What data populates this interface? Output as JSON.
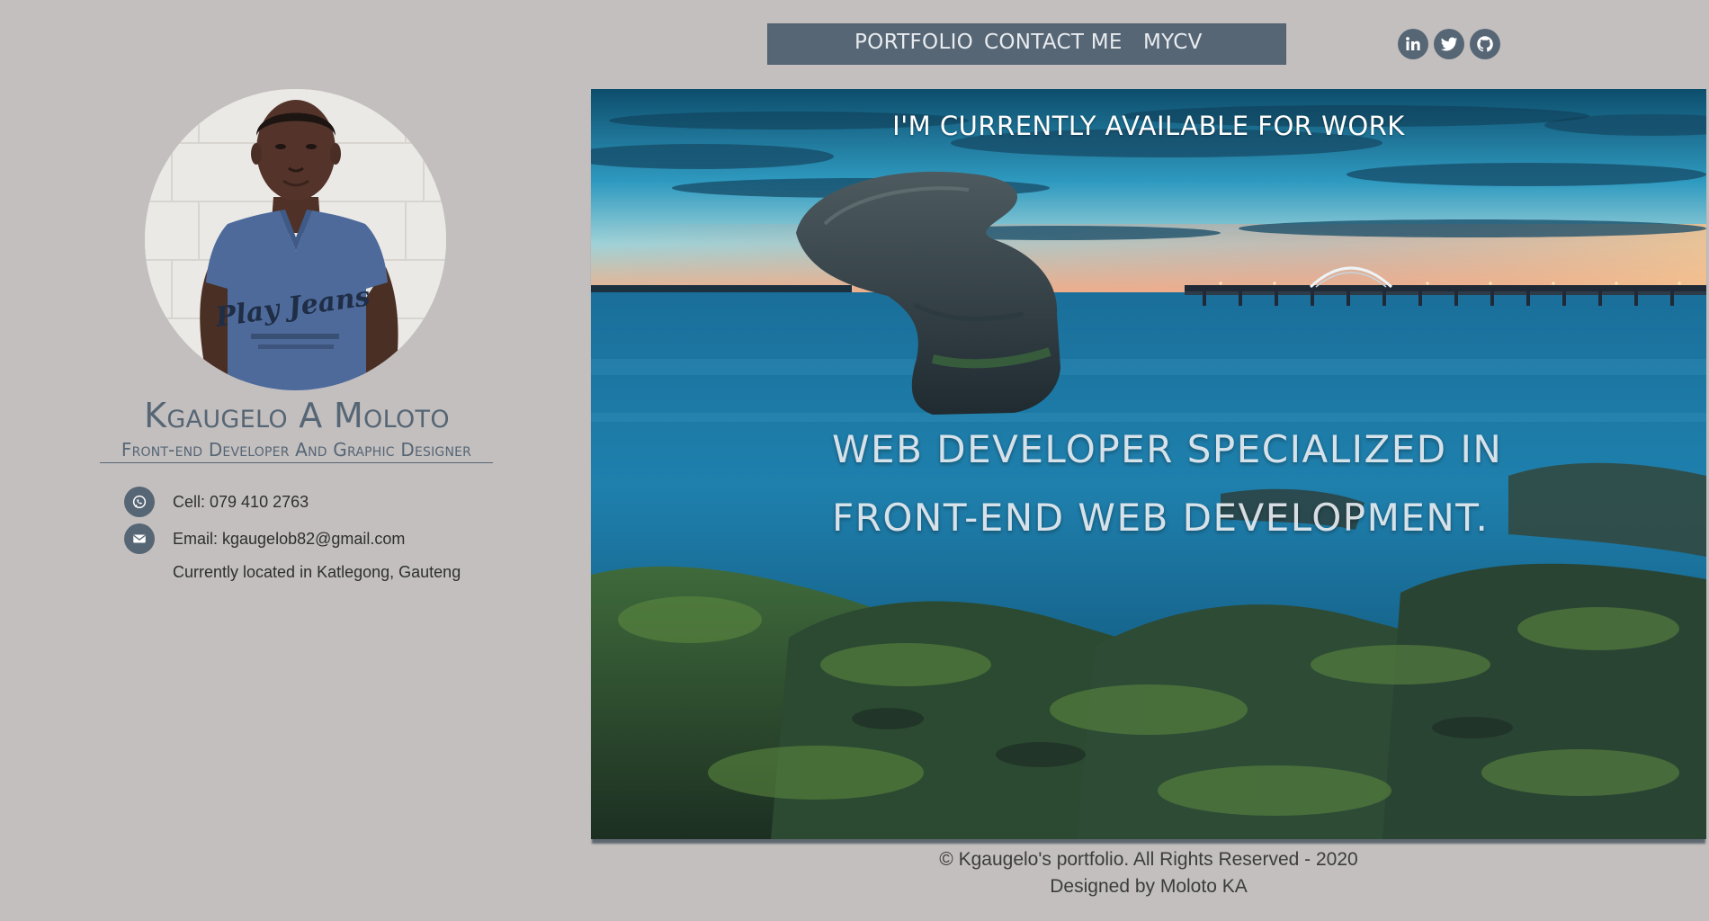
{
  "nav": {
    "links": [
      {
        "label": "PORTFOLIO"
      },
      {
        "label": "CONTACT ME"
      },
      {
        "label": "MYCV"
      }
    ]
  },
  "social": [
    {
      "name": "linkedin",
      "icon": "linkedin-icon"
    },
    {
      "name": "twitter",
      "icon": "twitter-icon"
    },
    {
      "name": "github",
      "icon": "github-icon"
    }
  ],
  "profile": {
    "name": "Kgaugelo A Moloto",
    "title": "Front-end Developer And Graphic Designer",
    "phone": "Cell: 079 410 2763",
    "email": "Email: kgaugelob82@gmail.com",
    "location": "Currently located in Katlegong, Gauteng",
    "shirt_text": "Play Jeans"
  },
  "hero": {
    "availability": "I'M CURRENTLY AVAILABLE FOR WORK",
    "headline_line1": "WEB DEVELOPER SPECIALIZED IN",
    "headline_line2": "FRONT-END WEB DEVELOPMENT."
  },
  "footer": {
    "copyright": "© Kgaugelo's portfolio. All Rights Reserved - 2020",
    "designer": "Designed by Moloto KA"
  },
  "colors": {
    "page_background": "#c3bfbf",
    "accent": "#566675",
    "nav_text": "#e8ebef"
  }
}
